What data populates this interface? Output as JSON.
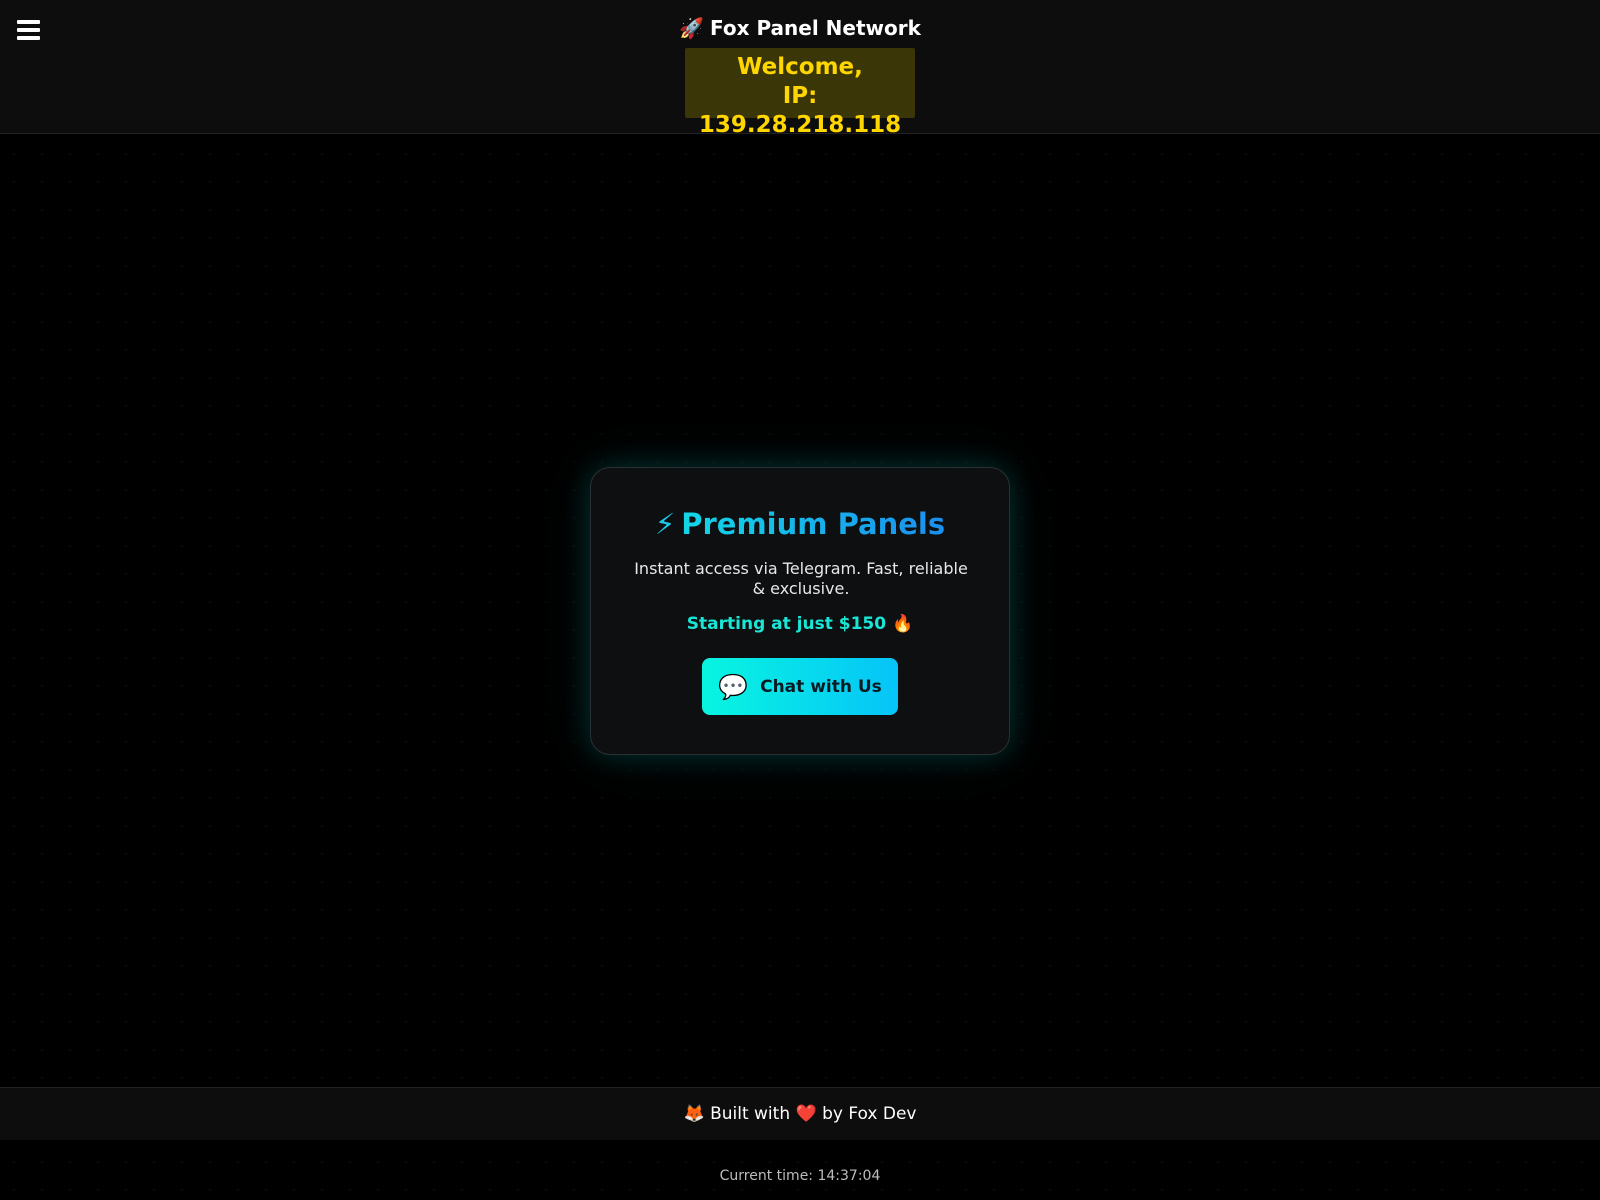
{
  "header": {
    "menu_icon": "hamburger-menu-icon",
    "title_icon": "🚀",
    "title": "Fox Panel Network",
    "welcome_line1": "Welcome,",
    "welcome_line2": "IP: 139.28.218.118",
    "colors": {
      "background": "#0d0d0d",
      "welcome_bg": "#3a3608",
      "welcome_text": "#ffd600"
    }
  },
  "card": {
    "title_icon": "⚡",
    "title": "Premium Panels",
    "description": "Instant access via Telegram. Fast, reliable & exclusive.",
    "price": "Starting at just $150 🔥",
    "button_icon": "💬",
    "button_label": "Chat with Us",
    "colors": {
      "accent": "#19e6d6",
      "title_gradient": [
        "#14d6e6",
        "#1a8ff0"
      ],
      "button_gradient": [
        "#08f5e0",
        "#06c4f8"
      ]
    }
  },
  "footer": {
    "fox_icon": "🦊",
    "text_before_heart": "Built with",
    "heart_icon": "❤️",
    "text_after_heart": "by Fox Dev",
    "current_time": "Current time: 14:37:04"
  }
}
